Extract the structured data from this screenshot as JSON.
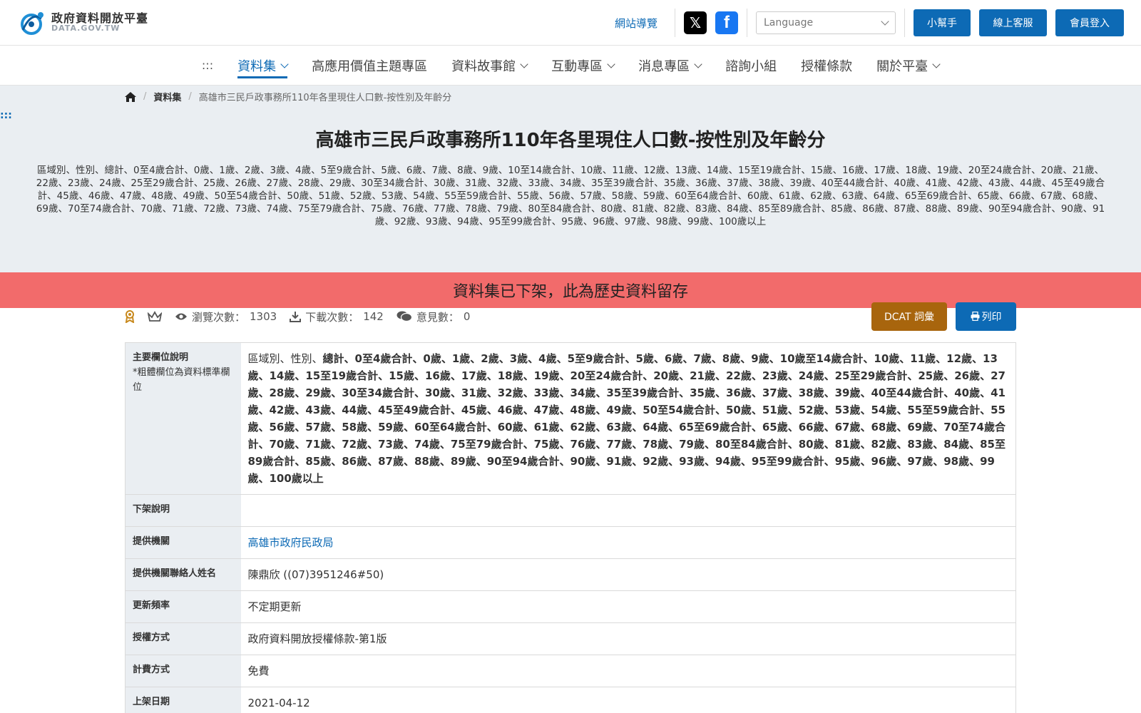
{
  "header": {
    "logo_cn": "政府資料開放平臺",
    "logo_en": "DATA.GOV.TW",
    "sitemap": "網站導覽",
    "language_placeholder": "Language",
    "buttons": {
      "helper": "小幫手",
      "support": "線上客服",
      "login": "會員登入"
    }
  },
  "nav": {
    "accesskey": ":::",
    "items": [
      {
        "label": "資料集",
        "dropdown": true,
        "active": true
      },
      {
        "label": "高應用價值主題專區",
        "dropdown": false
      },
      {
        "label": "資料故事館",
        "dropdown": true
      },
      {
        "label": "互動專區",
        "dropdown": true
      },
      {
        "label": "消息專區",
        "dropdown": true
      },
      {
        "label": "諮詢小組",
        "dropdown": false
      },
      {
        "label": "授權條款",
        "dropdown": false
      },
      {
        "label": "關於平臺",
        "dropdown": true
      }
    ]
  },
  "breadcrumb": {
    "home_icon": "home-icon",
    "level1": "資料集",
    "current": "高雄市三民戶政事務所110年各里現住人口數-按性別及年齡分"
  },
  "side_accesskey": ":::",
  "dataset": {
    "title": "高雄市三民戶政事務所110年各里現住人口數-按性別及年齡分",
    "description": "區域別、性別、總計、0至4歲合計、0歲、1歲、2歲、3歲、4歲、5至9歲合計、5歲、6歲、7歲、8歲、9歲、10至14歲合計、10歲、11歲、12歲、13歲、14歲、15至19歲合計、15歲、16歲、17歲、18歲、19歲、20至24歲合計、20歲、21歲、22歲、23歲、24歲、25至29歲合計、25歲、26歲、27歲、28歲、29歲、30至34歲合計、30歲、31歲、32歲、33歲、34歲、35至39歲合計、35歲、36歲、37歲、38歲、39歲、40至44歲合計、40歲、41歲、42歲、43歲、44歲、45至49歲合計、45歲、46歲、47歲、48歲、49歲、50至54歲合計、50歲、51歲、52歲、53歲、54歲、55至59歲合計、55歲、56歲、57歲、58歲、59歲、60至64歲合計、60歲、61歲、62歲、63歲、64歲、65至69歲合計、65歲、66歲、67歲、68歲、69歲、70至74歲合計、70歲、71歲、72歲、73歲、74歲、75至79歲合計、75歲、76歲、77歲、78歲、79歲、80至84歲合計、80歲、81歲、82歲、83歲、84歲、85至89歲合計、85歲、86歲、87歲、88歲、89歲、90至94歲合計、90歲、91歲、92歲、93歲、94歲、95至99歲合計、95歲、96歲、97歲、98歲、99歲、100歲以上"
  },
  "banner": "資料集已下架，此為歷史資料留存",
  "stats": {
    "views_label": "瀏覽次數：",
    "views": "1303",
    "downloads_label": "下載次數：",
    "downloads": "142",
    "comments_label": "意見數：",
    "comments": "0",
    "icons": [
      "award-icon",
      "crown-icon",
      "eye-icon",
      "download-icon",
      "comments-icon",
      "print-icon"
    ],
    "dcat_button": "DCAT 詞彙",
    "print_button": "列印"
  },
  "table": {
    "fields": {
      "label": "主要欄位說明",
      "note": "*粗體欄位為資料標準欄位",
      "plain_prefix": "區域別、性別、",
      "bold_value": "總計、0至4歲合計、0歲、1歲、2歲、3歲、4歲、5至9歲合計、5歲、6歲、7歲、8歲、9歲、10歲至14歲合計、10歲、11歲、12歲、13歲、14歲、15至19歲合計、15歲、16歲、17歲、18歲、19歲、20至24歲合計、20歲、21歲、22歲、23歲、24歲、25至29歲合計、25歲、26歲、27歲、28歲、29歲、30至34歲合計、30歲、31歲、32歲、33歲、34歲、35至39歲合計、35歲、36歲、37歲、38歲、39歲、40至44歲合計、40歲、41歲、42歲、43歲、44歲、45至49歲合計、45歲、46歲、47歲、48歲、49歲、50至54歲合計、50歲、51歲、52歲、53歲、54歲、55至59歲合計、55歲、56歲、57歲、58歲、59歲、60至64歲合計、60歲、61歲、62歲、63歲、64歲、65至69歲合計、65歲、66歲、67歲、68歲、69歲、70至74歲合計、70歲、71歲、72歲、73歲、74歲、75至79歲合計、75歲、76歲、77歲、78歲、79歲、80至84歲合計、80歲、81歲、82歲、83歲、84歲、85至89歲合計、85歲、86歲、87歲、88歲、89歲、90至94歲合計、90歲、91歲、92歲、93歲、94歲、95至99歲合計、95歲、96歲、97歲、98歲、99歲、100歲以上"
    },
    "removal": {
      "label": "下架說明",
      "value": ""
    },
    "agency": {
      "label": "提供機關",
      "value": "高雄市政府民政局"
    },
    "contact": {
      "label": "提供機關聯絡人姓名",
      "value": "陳鼎欣 ((07)3951246#50)"
    },
    "frequency": {
      "label": "更新頻率",
      "value": "不定期更新"
    },
    "license": {
      "label": "授權方式",
      "value": "政府資料開放授權條款-第1版"
    },
    "fee": {
      "label": "計費方式",
      "value": "免費"
    },
    "published": {
      "label": "上架日期",
      "value": "2021-04-12"
    }
  },
  "colors": {
    "primary": "#0d6ab5",
    "banner": "#f26b6b",
    "dcat": "#a8650d",
    "hero_bg": "#eaeef2"
  }
}
